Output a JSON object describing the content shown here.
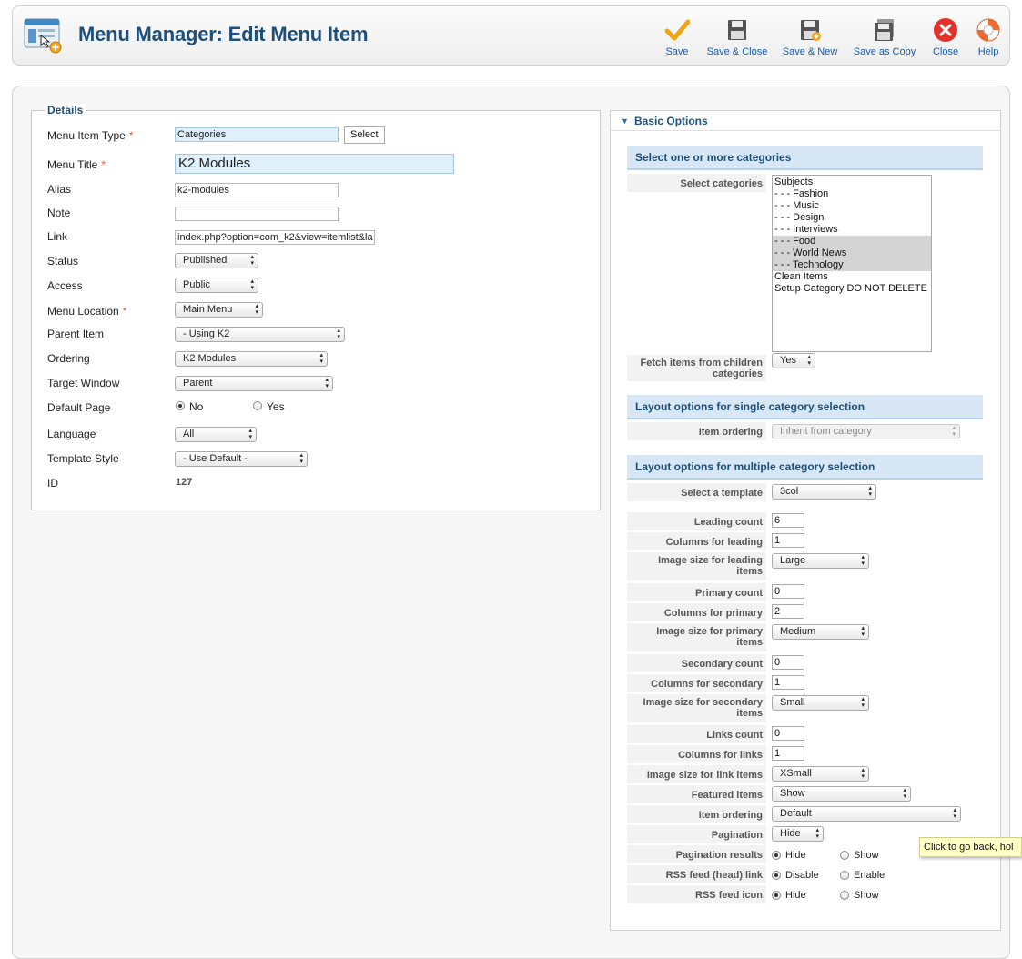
{
  "header": {
    "title": "Menu Manager: Edit Menu Item"
  },
  "toolbar": {
    "save": "Save",
    "save_close": "Save & Close",
    "save_new": "Save & New",
    "save_copy": "Save as Copy",
    "close": "Close",
    "help": "Help"
  },
  "details": {
    "legend": "Details",
    "menu_item_type": {
      "label": "Menu Item Type",
      "value": "Categories",
      "button": "Select"
    },
    "menu_title": {
      "label": "Menu Title",
      "value": "K2 Modules"
    },
    "alias": {
      "label": "Alias",
      "value": "k2-modules"
    },
    "note": {
      "label": "Note",
      "value": ""
    },
    "link": {
      "label": "Link",
      "value": "index.php?option=com_k2&view=itemlist&la"
    },
    "status": {
      "label": "Status",
      "value": "Published"
    },
    "access": {
      "label": "Access",
      "value": "Public"
    },
    "menu_location": {
      "label": "Menu Location",
      "value": "Main Menu"
    },
    "parent_item": {
      "label": "Parent Item",
      "value": "- Using K2"
    },
    "ordering": {
      "label": "Ordering",
      "value": "K2 Modules"
    },
    "target_window": {
      "label": "Target Window",
      "value": "Parent"
    },
    "default_page": {
      "label": "Default Page",
      "no": "No",
      "yes": "Yes"
    },
    "language": {
      "label": "Language",
      "value": "All"
    },
    "template_style": {
      "label": "Template Style",
      "value": "- Use Default -"
    },
    "id": {
      "label": "ID",
      "value": "127"
    }
  },
  "basic": {
    "title": "Basic Options",
    "section_categories": "Select one or more categories",
    "select_categories_label": "Select categories",
    "categories": [
      {
        "label": "Subjects",
        "selected": false
      },
      {
        "label": "- - - Fashion",
        "selected": false
      },
      {
        "label": "- - - Music",
        "selected": false
      },
      {
        "label": "- - - Design",
        "selected": false
      },
      {
        "label": "- - - Interviews",
        "selected": false
      },
      {
        "label": "- - - Food",
        "selected": true
      },
      {
        "label": "- - - World News",
        "selected": true
      },
      {
        "label": "- - - Technology",
        "selected": true
      },
      {
        "label": "Clean Items",
        "selected": false
      },
      {
        "label": "Setup Category DO NOT DELETE",
        "selected": false
      }
    ],
    "fetch_children": {
      "label1": "Fetch items from children",
      "label2": "categories",
      "value": "Yes"
    },
    "section_single": "Layout options for single category selection",
    "single_item_ordering": {
      "label": "Item ordering",
      "value": "Inherit from category"
    },
    "section_multiple": "Layout options for multiple category selection",
    "select_template": {
      "label": "Select a template",
      "value": "3col"
    },
    "leading_count": {
      "label": "Leading count",
      "value": "6"
    },
    "columns_leading": {
      "label": "Columns for leading",
      "value": "1"
    },
    "image_size_leading": {
      "label1": "Image size for leading",
      "label2": "items",
      "value": "Large"
    },
    "primary_count": {
      "label": "Primary count",
      "value": "0"
    },
    "columns_primary": {
      "label": "Columns for primary",
      "value": "2"
    },
    "image_size_primary": {
      "label1": "Image size for primary",
      "label2": "items",
      "value": "Medium"
    },
    "secondary_count": {
      "label": "Secondary count",
      "value": "0"
    },
    "columns_secondary": {
      "label": "Columns for secondary",
      "value": "1"
    },
    "image_size_secondary": {
      "label1": "Image size for secondary",
      "label2": "items",
      "value": "Small"
    },
    "links_count": {
      "label": "Links count",
      "value": "0"
    },
    "columns_links": {
      "label": "Columns for links",
      "value": "1"
    },
    "image_size_links": {
      "label": "Image size for link items",
      "value": "XSmall"
    },
    "featured_items": {
      "label": "Featured items",
      "value": "Show"
    },
    "item_ordering": {
      "label": "Item ordering",
      "value": "Default"
    },
    "pagination": {
      "label": "Pagination",
      "value": "Hide"
    },
    "pagination_results": {
      "label": "Pagination results",
      "opt1": "Hide",
      "opt2": "Show"
    },
    "rss_head_link": {
      "label": "RSS feed (head) link",
      "opt1": "Disable",
      "opt2": "Enable"
    },
    "rss_icon": {
      "label": "RSS feed icon",
      "opt1": "Hide",
      "opt2": "Show"
    }
  },
  "tooltip": {
    "text": "Click to go back, hol"
  }
}
